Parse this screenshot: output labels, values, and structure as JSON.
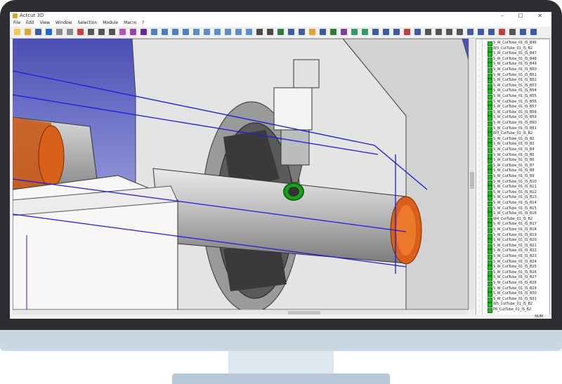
{
  "window": {
    "title": "Actcut 3D",
    "controls": "– ☐ ✕"
  },
  "menu": [
    "File",
    "Edit",
    "View",
    "Window",
    "Selection",
    "Module",
    "Macro",
    "?"
  ],
  "toolbar_icons": [
    {
      "name": "new-icon",
      "color": "#f2c94c"
    },
    {
      "name": "open-icon",
      "color": "#e0a530"
    },
    {
      "name": "save-icon",
      "color": "#3c5aa8"
    },
    {
      "name": "select-icon",
      "color": "#1b6fd1"
    },
    {
      "name": "undo-icon",
      "color": "#8a8a8a"
    },
    {
      "name": "redo-icon",
      "color": "#8a8a8a"
    },
    {
      "name": "cut-icon",
      "color": "#d13b3b"
    },
    {
      "name": "dimension-icon",
      "color": "#555"
    },
    {
      "name": "arc-icon",
      "color": "#555"
    },
    {
      "name": "tool-icon",
      "color": "#555"
    },
    {
      "name": "render-icon",
      "color": "#b84fc3"
    },
    {
      "name": "shade-icon",
      "color": "#9a3fb0"
    },
    {
      "name": "material-icon",
      "color": "#6a2b9a"
    },
    {
      "name": "pan-icon",
      "color": "#4a7fc0"
    },
    {
      "name": "move-icon",
      "color": "#4a7fc0"
    },
    {
      "name": "zoom-in-icon",
      "color": "#4a7fc0"
    },
    {
      "name": "zoom-out-icon",
      "color": "#4a7fc0"
    },
    {
      "name": "view-front-icon",
      "color": "#5b8ec9"
    },
    {
      "name": "view-back-icon",
      "color": "#5b8ec9"
    },
    {
      "name": "view-left-icon",
      "color": "#5b8ec9"
    },
    {
      "name": "view-right-icon",
      "color": "#5b8ec9"
    },
    {
      "name": "view-top-icon",
      "color": "#5b8ec9"
    },
    {
      "name": "view-iso-icon",
      "color": "#5b8ec9"
    },
    {
      "name": "fit-icon",
      "color": "#4a4a4a"
    },
    {
      "name": "section-icon",
      "color": "#4a4a4a"
    },
    {
      "name": "measure-icon",
      "color": "#2f7d32"
    },
    {
      "name": "snap-icon",
      "color": "#3c5aa8"
    },
    {
      "name": "magnet-icon",
      "color": "#3c5aa8"
    },
    {
      "name": "light-icon",
      "color": "#e0a530"
    },
    {
      "name": "grid-icon",
      "color": "#3c5aa8"
    },
    {
      "name": "axis-icon",
      "color": "#2f7d32"
    },
    {
      "name": "flag-icon",
      "color": "#7b3fa0"
    },
    {
      "name": "bevel-icon",
      "color": "#2f9a6a"
    },
    {
      "name": "joint-icon",
      "color": "#2f9a6a"
    },
    {
      "name": "hole-icon",
      "color": "#3c5aa8"
    },
    {
      "name": "slot-icon",
      "color": "#3c5aa8"
    },
    {
      "name": "notch-icon",
      "color": "#3c5aa8"
    },
    {
      "name": "weld-icon",
      "color": "#c03e3e"
    },
    {
      "name": "mark-icon",
      "color": "#3c5aa8"
    },
    {
      "name": "nest-icon",
      "color": "#555"
    },
    {
      "name": "sheet-icon",
      "color": "#555"
    },
    {
      "name": "layer-icon",
      "color": "#555"
    },
    {
      "name": "pencil-icon",
      "color": "#555"
    },
    {
      "name": "simulate-icon",
      "color": "#3c5aa8"
    },
    {
      "name": "play-icon",
      "color": "#3c5aa8"
    },
    {
      "name": "step-icon",
      "color": "#3c5aa8"
    },
    {
      "name": "stop-icon",
      "color": "#c03e3e"
    },
    {
      "name": "settings-icon",
      "color": "#555"
    },
    {
      "name": "help-icon",
      "color": "#3c5aa8"
    },
    {
      "name": "info-icon",
      "color": "#3c5aa8"
    }
  ],
  "tree": {
    "items": [
      "S_W_CutTube_01_IS_B46",
      "W3_CutTube_01_IS_B2",
      "S_W_CutTube_01_IS_B47",
      "S_W_CutTube_01_IS_B48",
      "S_W_CutTube_01_IS_B49",
      "S_W_CutTube_01_IS_B50",
      "S_W_CutTube_01_IS_B51",
      "S_W_CutTube_01_IS_B52",
      "S_W_CutTube_01_IS_B53",
      "S_W_CutTube_01_IS_B54",
      "S_W_CutTube_01_IS_B55",
      "S_W_CutTube_01_IS_B56",
      "S_W_CutTube_01_IS_B57",
      "S_W_CutTube_01_IS_B58",
      "S_W_CutTube_01_IS_B59",
      "S_W_CutTube_01_IS_B60",
      "S_W_CutTube_01_IS_B61",
      "W3_CutTube_01_IS_B2",
      "S_W_CutTube_01_IS_B2",
      "S_W_CutTube_01_IS_B3",
      "S_W_CutTube_01_IS_B4",
      "S_W_CutTube_01_IS_B5",
      "S_W_CutTube_01_IS_B6",
      "S_W_CutTube_01_IS_B7",
      "S_W_CutTube_01_IS_B8",
      "S_W_CutTube_01_IS_B9",
      "S_W_CutTube_01_IS_B10",
      "S_W_CutTube_01_IS_B11",
      "S_W_CutTube_01_IS_B12",
      "S_W_CutTube_01_IS_B13",
      "S_W_CutTube_01_IS_B14",
      "S_W_CutTube_01_IS_B15",
      "S_W_CutTube_01_IS_B16",
      "W4_CutTube_01_IS_B2",
      "S_W_CutTube_01_IS_B17",
      "S_W_CutTube_01_IS_B18",
      "S_W_CutTube_01_IS_B19",
      "S_W_CutTube_01_IS_B20",
      "S_W_CutTube_01_IS_B21",
      "S_W_CutTube_01_IS_B22",
      "S_W_CutTube_01_IS_B23",
      "S_W_CutTube_01_IS_B24",
      "S_W_CutTube_01_IS_B25",
      "S_W_CutTube_01_IS_B26",
      "S_W_CutTube_01_IS_B27",
      "S_W_CutTube_01_IS_B28",
      "S_W_CutTube_01_IS_B29",
      "S_W_CutTube_01_IS_B30",
      "S_W_CutTube_01_IS_B31",
      "W5_CutTube_01_IS_B2",
      "P6_CutTube_01_IS_B2"
    ],
    "check_color": "#16c016"
  },
  "status": {
    "num_indicator": "NUM"
  },
  "colors": {
    "bezel": "#2b2d30",
    "stand": "#c9d7e3",
    "viewport_bg": "#5a5fb8",
    "tube": "#bdbdbd",
    "tube_cut": "#d9601a",
    "highlight": "#22c022",
    "frame_line": "#1a1ae0"
  }
}
